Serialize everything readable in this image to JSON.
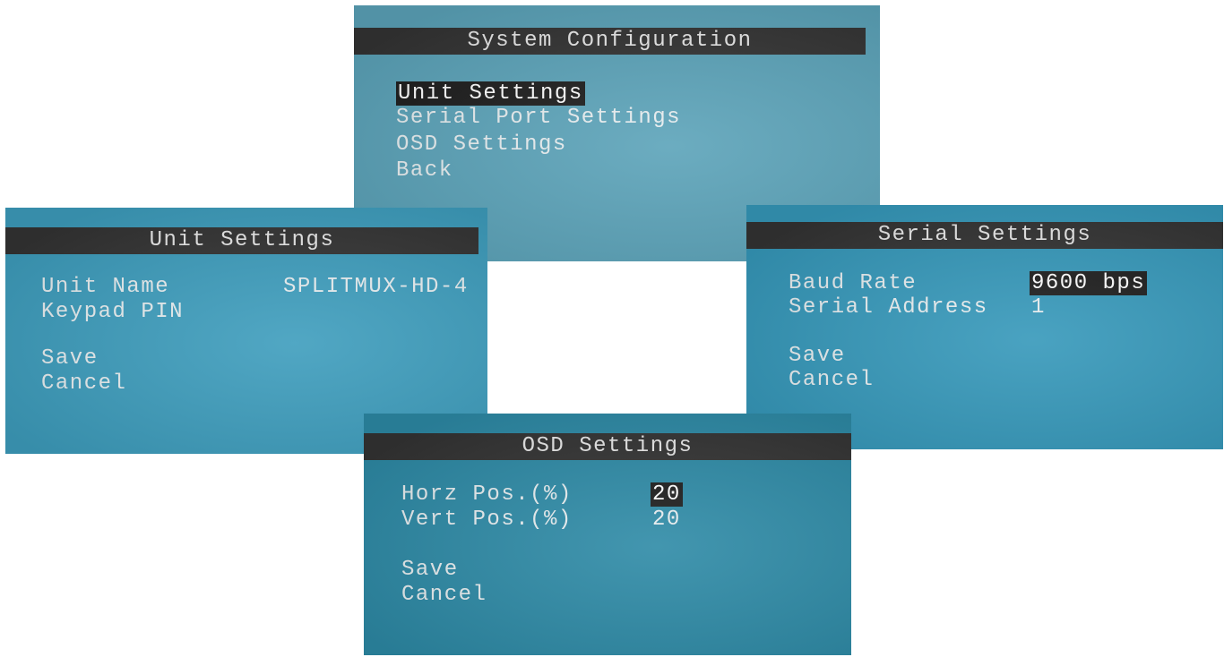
{
  "system_config": {
    "title": "System Configuration",
    "menu": [
      {
        "label": "Unit Settings",
        "selected": true
      },
      {
        "label": "Serial Port Settings",
        "selected": false
      },
      {
        "label": "OSD Settings",
        "selected": false
      },
      {
        "label": "Back",
        "selected": false
      }
    ]
  },
  "unit_settings": {
    "title": "Unit Settings",
    "unit_name_label": "Unit Name",
    "unit_name_value": "SPLITMUX-HD-4",
    "keypad_pin_label": "Keypad PIN",
    "keypad_pin_value": "",
    "save_label": "Save",
    "cancel_label": "Cancel"
  },
  "serial_settings": {
    "title": "Serial Settings",
    "baud_rate_label": "Baud Rate",
    "baud_rate_value": "9600 bps",
    "serial_address_label": "Serial Address",
    "serial_address_value": "1",
    "save_label": "Save",
    "cancel_label": "Cancel"
  },
  "osd_settings": {
    "title": "OSD Settings",
    "horz_pos_label": "Horz Pos.(%)",
    "horz_pos_value": "20",
    "vert_pos_label": "Vert Pos.(%)",
    "vert_pos_value": "20",
    "save_label": "Save",
    "cancel_label": "Cancel"
  },
  "colors": {
    "titlebar": "#333333",
    "highlight": "#1c1c1c",
    "screen_text": "#e8eef0"
  }
}
